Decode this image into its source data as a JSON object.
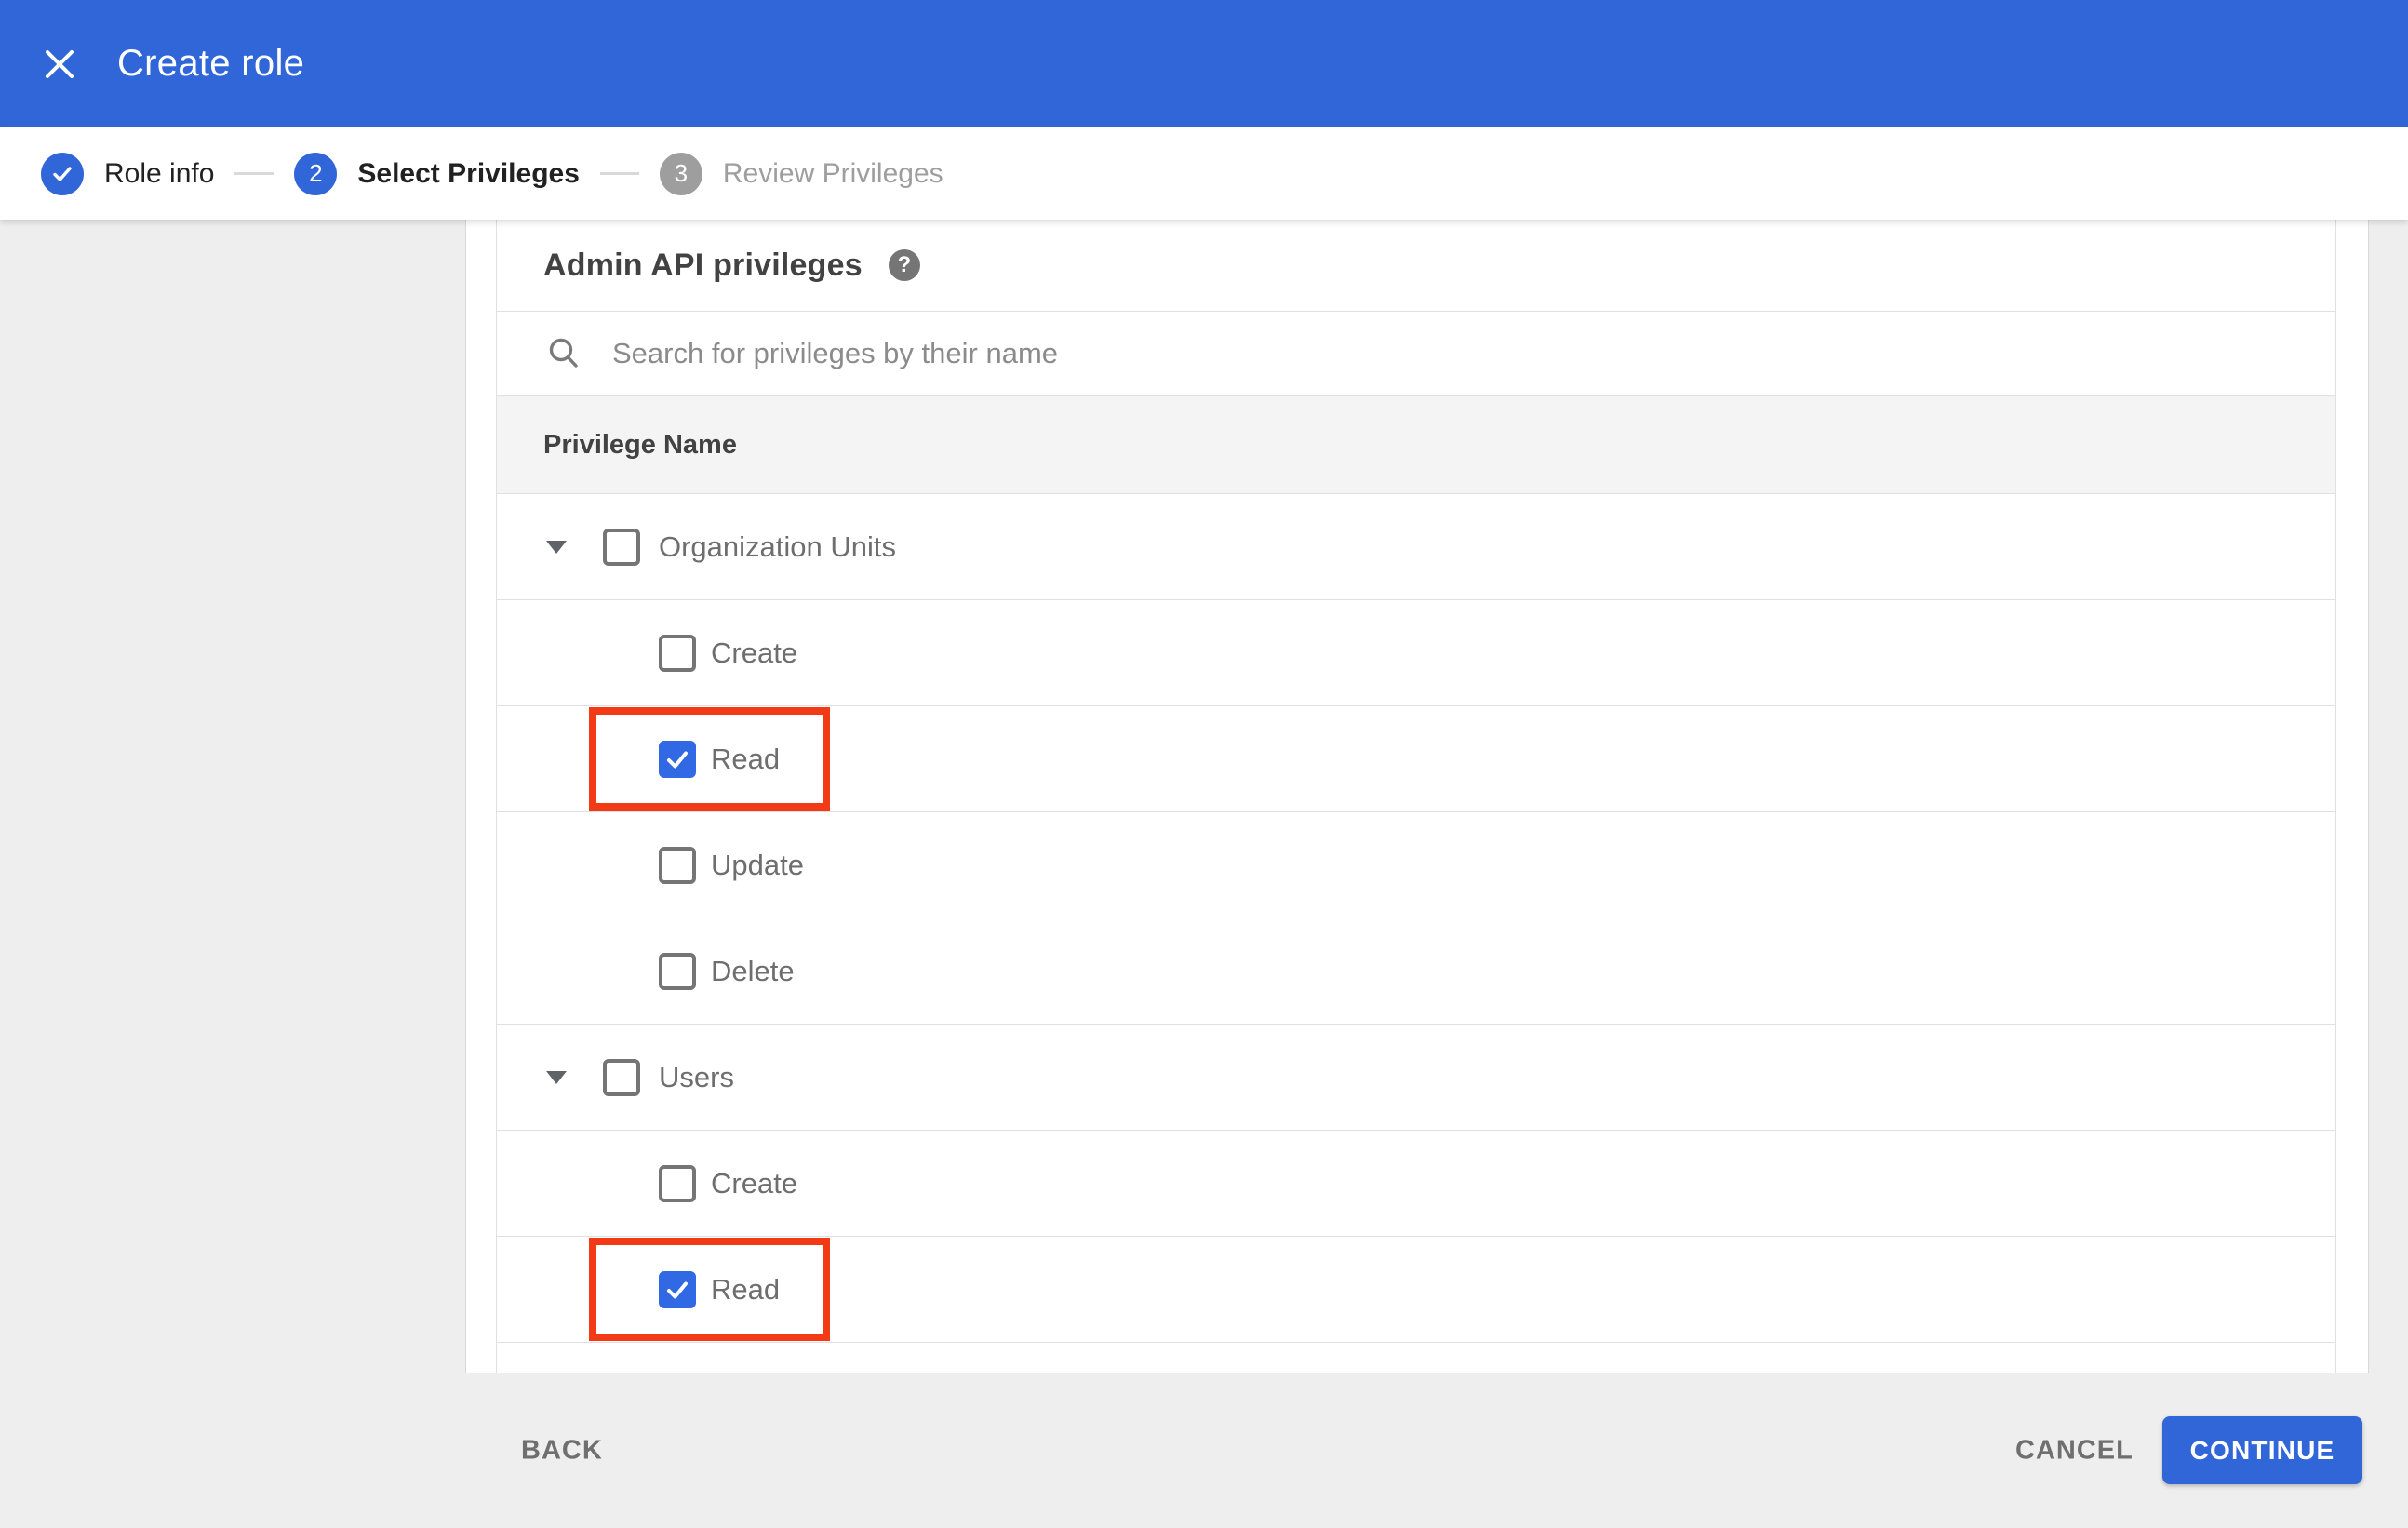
{
  "app_bar": {
    "title": "Create role",
    "close_icon": "close-x"
  },
  "stepper": {
    "steps": [
      {
        "number": "1",
        "label": "Role info",
        "state": "completed",
        "icon": "checkmark"
      },
      {
        "number": "2",
        "label": "Select Privileges",
        "state": "current"
      },
      {
        "number": "3",
        "label": "Review Privileges",
        "state": "upcoming"
      }
    ]
  },
  "content": {
    "section_title": "Admin API privileges",
    "help_icon_glyph": "?",
    "search": {
      "placeholder": "Search for privileges by their name",
      "value": "",
      "icon": "magnifier"
    },
    "table": {
      "header": "Privilege Name",
      "rows": [
        {
          "label": "Organization Units",
          "level": "group",
          "checked": false,
          "highlighted": false
        },
        {
          "label": "Create",
          "level": "child",
          "checked": false,
          "highlighted": false
        },
        {
          "label": "Read",
          "level": "child",
          "checked": true,
          "highlighted": true
        },
        {
          "label": "Update",
          "level": "child",
          "checked": false,
          "highlighted": false
        },
        {
          "label": "Delete",
          "level": "child",
          "checked": false,
          "highlighted": false
        },
        {
          "label": "Users",
          "level": "group",
          "checked": false,
          "highlighted": false
        },
        {
          "label": "Create",
          "level": "child",
          "checked": false,
          "highlighted": false
        },
        {
          "label": "Read",
          "level": "child",
          "checked": true,
          "highlighted": true
        }
      ]
    }
  },
  "footer": {
    "back_label": "BACK",
    "cancel_label": "CANCEL",
    "continue_label": "CONTINUE"
  },
  "colors": {
    "accent_blue": "#3166d9",
    "checkbox_blue": "#3069e3",
    "highlight_red": "#f23a17",
    "sidebar_bg": "#eeeeee",
    "table_header_bg": "#f4f4f4",
    "border": "#e0e0e0",
    "heading_text": "#424242",
    "row_text": "#6e6e6e",
    "step_inactive": "#9e9e9e"
  }
}
